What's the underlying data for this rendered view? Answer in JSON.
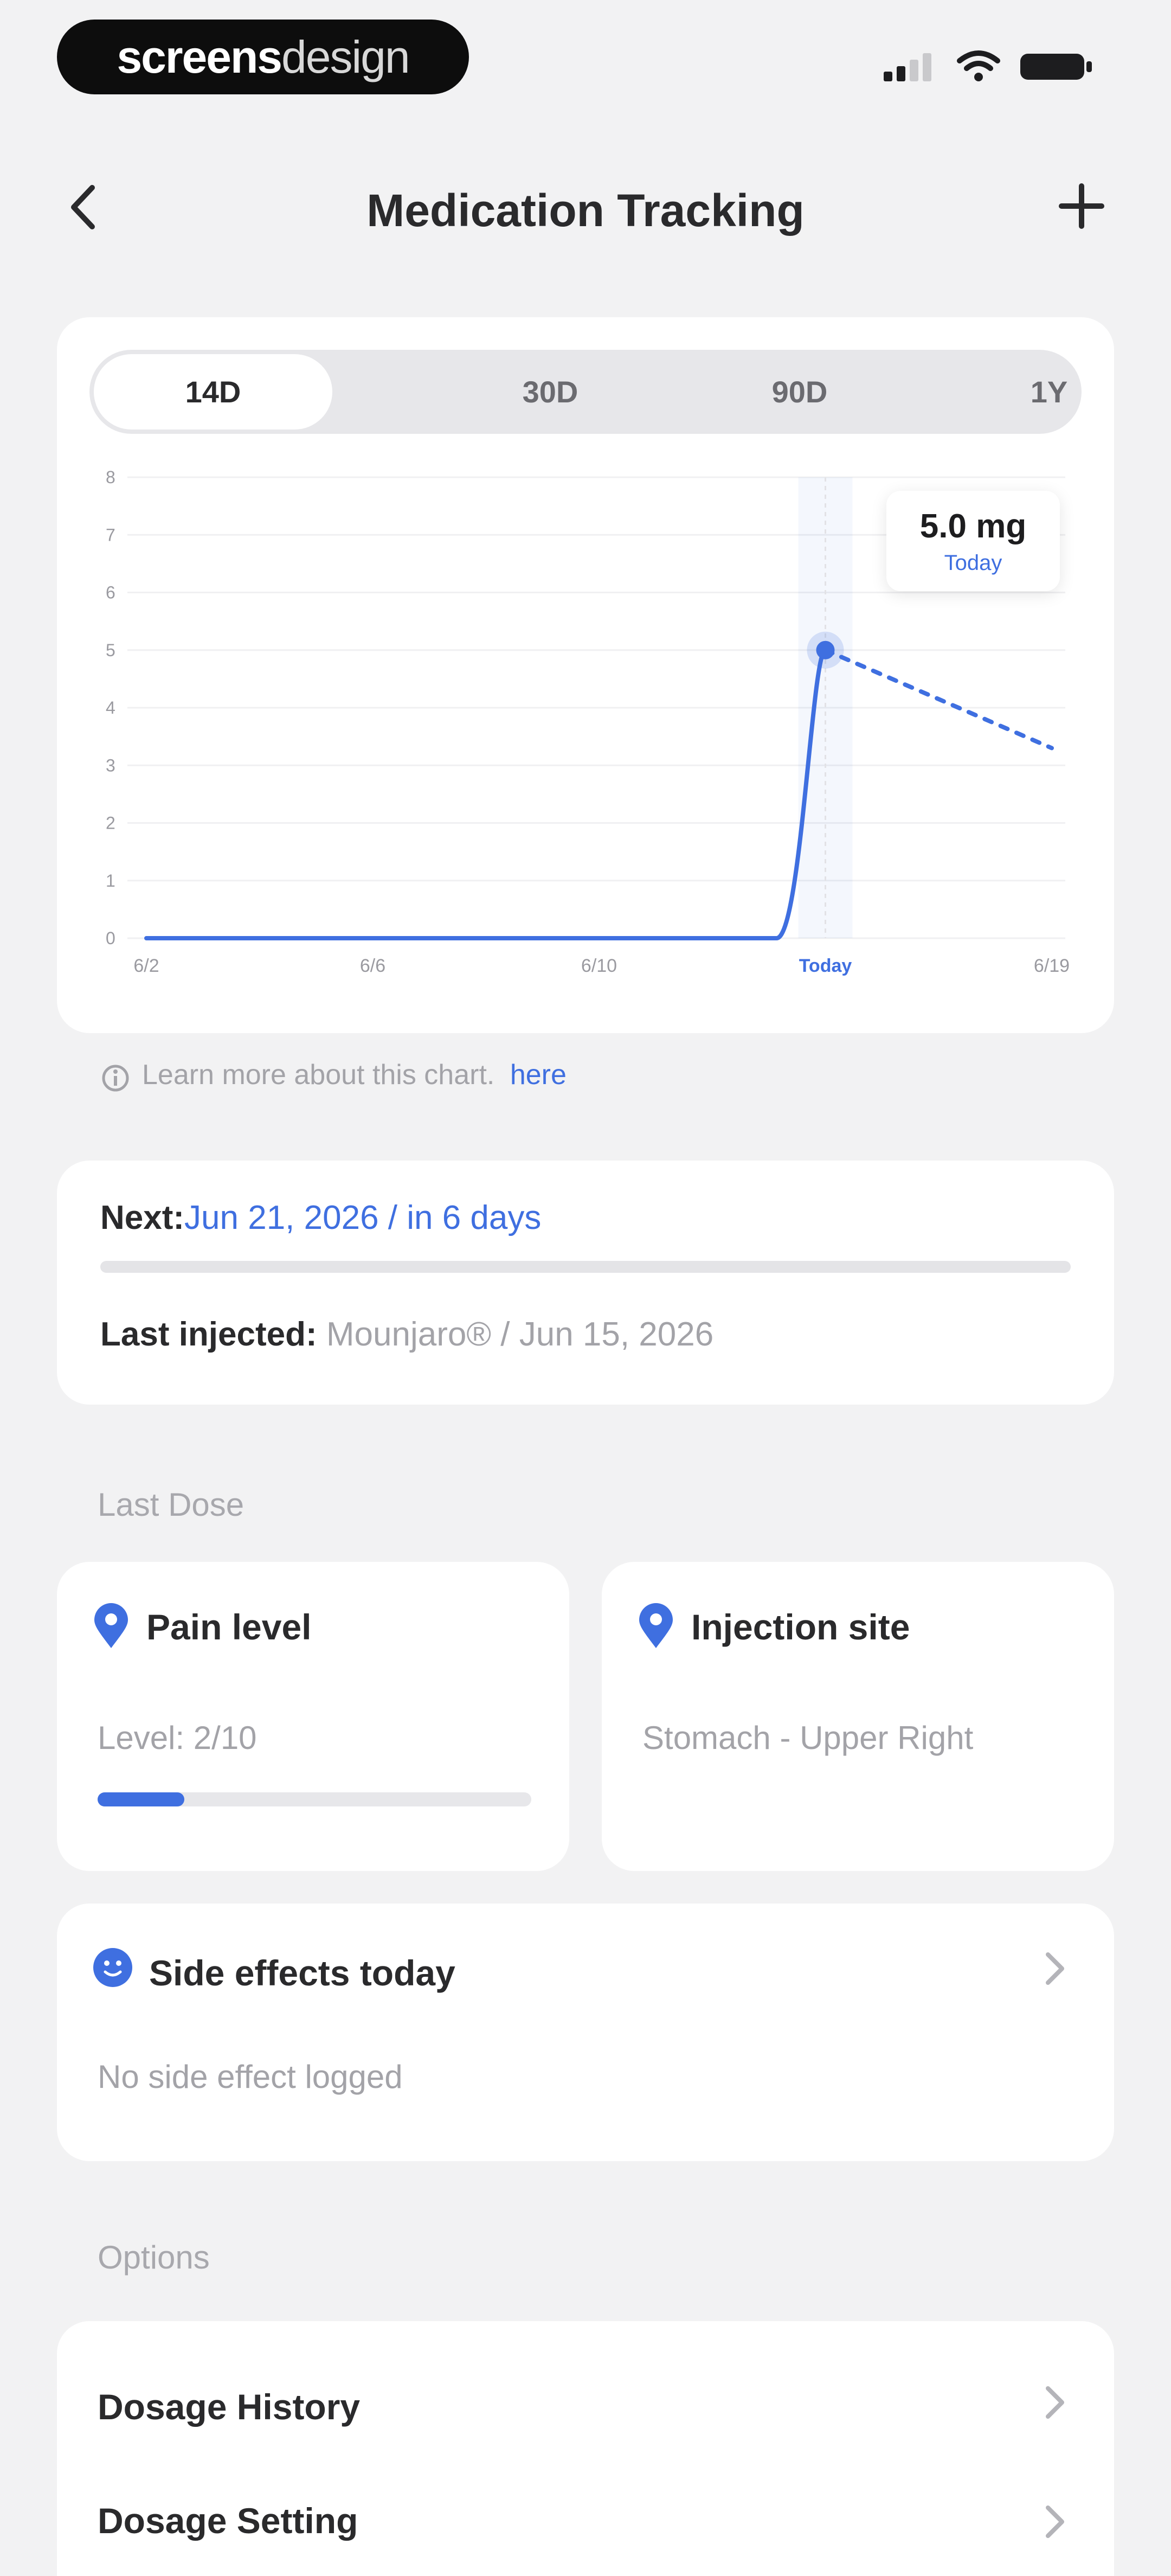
{
  "status": {
    "brand_bold": "screens",
    "brand_light": "design"
  },
  "header": {
    "title": "Medication Tracking"
  },
  "chart": {
    "tabs": [
      "14D",
      "30D",
      "90D",
      "1Y"
    ],
    "active_tab": "14D",
    "tooltip": {
      "value": "5.0 mg",
      "caption": "Today"
    },
    "x_labels": [
      "6/2",
      "6/6",
      "6/10",
      "Today",
      "6/19"
    ]
  },
  "chart_data": {
    "type": "line",
    "ylim": [
      0,
      8
    ],
    "yticks": [
      0,
      1,
      2,
      3,
      4,
      5,
      6,
      7,
      8
    ],
    "x": [
      "6/2",
      "6/6",
      "6/10",
      "Today",
      "6/19"
    ],
    "series": [
      {
        "values": [
          0,
          0,
          0,
          5,
          null
        ]
      },
      {
        "values": [
          null,
          null,
          null,
          5,
          3.3
        ],
        "style": "dashed"
      }
    ],
    "accent": "#3f6fe0",
    "grid": true
  },
  "info": {
    "text": "Learn more about this chart.",
    "link": "here"
  },
  "next_card": {
    "next_label": "Next:",
    "next_value": "Jun 21, 2026 / in 6 days",
    "last_label": "Last injected:",
    "last_value": "Mounjaro® / Jun 15, 2026"
  },
  "last_dose": {
    "section": "Last Dose",
    "pain": {
      "title": "Pain level",
      "value": "Level: 2/10",
      "level": 0.2
    },
    "site": {
      "title": "Injection site",
      "value": "Stomach - Upper Right"
    }
  },
  "side_effects": {
    "title": "Side effects today",
    "subtitle": "No side effect logged"
  },
  "options": {
    "section": "Options",
    "items": [
      "Dosage History",
      "Dosage Setting"
    ]
  }
}
